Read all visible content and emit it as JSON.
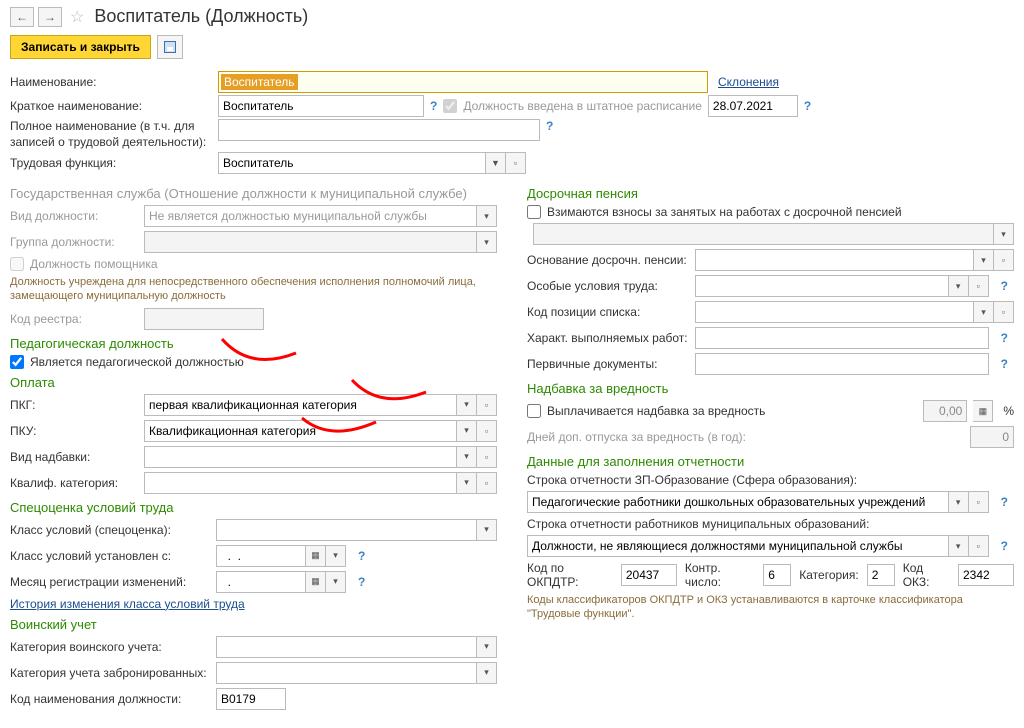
{
  "page_title": "Воспитатель (Должность)",
  "btn_save_close": "Записать и закрыть",
  "lbl_name": "Наименование:",
  "val_name": "Воспитатель",
  "link_declension": "Склонения",
  "lbl_short": "Краткое наименование:",
  "val_short": "Воспитатель",
  "chk_staff_label": "Должность введена в штатное расписание",
  "val_staff_date": "28.07.2021",
  "lbl_full": "Полное наименование (в т.ч. для записей о трудовой деятельности):",
  "lbl_labor_func": "Трудовая функция:",
  "val_labor_func": "Воспитатель",
  "section_gov": "Государственная служба (Отношение должности к муниципальной службе)",
  "lbl_pos_type": "Вид должности:",
  "val_pos_type": "Не является должностью муниципальной службы",
  "lbl_pos_group": "Группа должности:",
  "chk_assistant": "Должность помощника",
  "hint_gov": "Должность учреждена для непосредственного обеспечения исполнения полномочий лица, замещающего муниципальную должность",
  "lbl_registry": "Код реестра:",
  "section_ped": "Педагогическая должность",
  "chk_ped": "Является педагогической должностью",
  "section_pay": "Оплата",
  "lbl_pkg": "ПКГ:",
  "val_pkg": "первая квалификационная категория",
  "lbl_pku": "ПКУ:",
  "val_pku": "Квалификационная категория",
  "lbl_allowance": "Вид надбавки:",
  "lbl_qual_cat": "Квалиф. категория:",
  "section_spec": "Спецоценка условий труда",
  "lbl_class_spec": "Класс условий (спецоценка):",
  "lbl_class_from": "Класс условий установлен с:",
  "val_class_from": "  .  .    ",
  "lbl_month_reg": "Месяц регистрации изменений:",
  "val_month_reg": "  .    ",
  "link_history": "История изменения класса условий труда",
  "section_military": "Воинский учет",
  "lbl_mil_cat": "Категория воинского учета:",
  "lbl_mil_reserved": "Категория учета забронированных:",
  "lbl_mil_code": "Код наименования должности:",
  "val_mil_code": "В0179",
  "section_early": "Досрочная пенсия",
  "chk_early": "Взимаются взносы за занятых на работах с досрочной пенсией",
  "lbl_early_base": "Основание досрочн. пенсии:",
  "lbl_special_cond": "Особые условия труда:",
  "lbl_pos_code": "Код позиции списка:",
  "lbl_work_char": "Характ. выполняемых работ:",
  "lbl_primary_docs": "Первичные документы:",
  "section_harm": "Надбавка за вредность",
  "chk_harm": "Выплачивается надбавка за вредность",
  "val_harm": "0,00",
  "lbl_harm_days": "Дней доп. отпуска за вредность (в год):",
  "val_harm_days": "0",
  "section_report": "Данные для заполнения отчетности",
  "lbl_rep_zp": "Строка отчетности ЗП-Образование (Сфера образования):",
  "val_rep_zp": "Педагогические работники дошкольных образовательных учреждений",
  "lbl_rep_mun": "Строка отчетности работников муниципальных образований:",
  "val_rep_mun": "Должности, не являющиеся должностями муниципальной службы",
  "lbl_okpdtr": "Код по ОКПДТР:",
  "val_okpdtr": "20437",
  "lbl_contr": "Контр. число:",
  "val_contr": "6",
  "lbl_category": "Категория:",
  "val_category": "2",
  "lbl_okz": "Код ОКЗ:",
  "val_okz": "2342",
  "hint_codes": "Коды классификаторов ОКПДТР и ОКЗ устанавливаются в карточке классификатора \"Трудовые функции\"."
}
